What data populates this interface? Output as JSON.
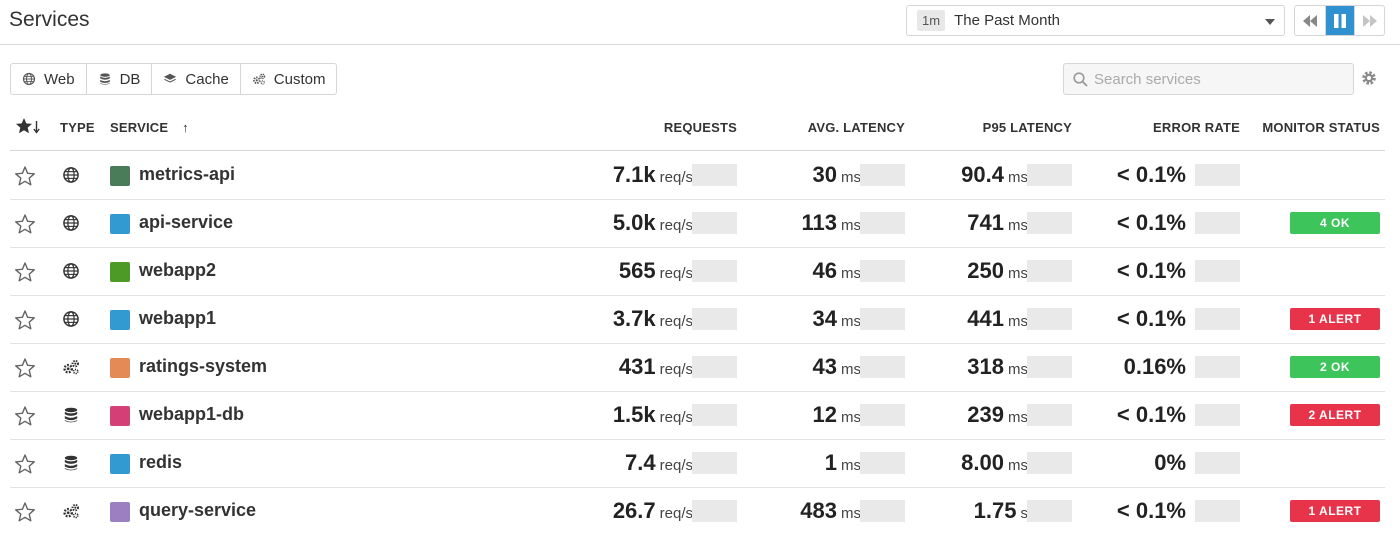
{
  "header": {
    "title": "Services",
    "timeframe": {
      "badge": "1m",
      "label": "The Past Month"
    }
  },
  "filters": [
    {
      "label": "Web",
      "icon": "globe-icon"
    },
    {
      "label": "DB",
      "icon": "database-icon"
    },
    {
      "label": "Cache",
      "icon": "layers-icon"
    },
    {
      "label": "Custom",
      "icon": "gears-icon"
    }
  ],
  "search": {
    "placeholder": "Search services",
    "value": ""
  },
  "columns": {
    "type": "TYPE",
    "service": "SERVICE",
    "sort_arrow": "↑",
    "requests": "REQUESTS",
    "avg_latency": "AVG. LATENCY",
    "p95_latency": "P95 LATENCY",
    "error_rate": "ERROR RATE",
    "monitor_status": "MONITOR STATUS"
  },
  "colors": {
    "ok": "#3dc55b",
    "alert": "#e8344b",
    "accent": "#2f91cf"
  },
  "services": [
    {
      "name": "metrics-api",
      "type": "globe-icon",
      "color": "#4a7c59",
      "requests": "7.1k",
      "requests_unit": "req/s",
      "avg": "30",
      "avg_unit": "ms",
      "p95": "90.4",
      "p95_unit": "ms",
      "error": "< 0.1%",
      "monitor": "",
      "monitor_kind": ""
    },
    {
      "name": "api-service",
      "type": "globe-icon",
      "color": "#3399d1",
      "requests": "5.0k",
      "requests_unit": "req/s",
      "avg": "113",
      "avg_unit": "ms",
      "p95": "741",
      "p95_unit": "ms",
      "error": "< 0.1%",
      "monitor": "4 OK",
      "monitor_kind": "ok"
    },
    {
      "name": "webapp2",
      "type": "globe-icon",
      "color": "#4e9a26",
      "requests": "565",
      "requests_unit": "req/s",
      "avg": "46",
      "avg_unit": "ms",
      "p95": "250",
      "p95_unit": "ms",
      "error": "< 0.1%",
      "monitor": "",
      "monitor_kind": ""
    },
    {
      "name": "webapp1",
      "type": "globe-icon",
      "color": "#3399d1",
      "requests": "3.7k",
      "requests_unit": "req/s",
      "avg": "34",
      "avg_unit": "ms",
      "p95": "441",
      "p95_unit": "ms",
      "error": "< 0.1%",
      "monitor": "1 ALERT",
      "monitor_kind": "alert"
    },
    {
      "name": "ratings-system",
      "type": "gears-icon",
      "color": "#e48a56",
      "requests": "431",
      "requests_unit": "req/s",
      "avg": "43",
      "avg_unit": "ms",
      "p95": "318",
      "p95_unit": "ms",
      "error": "0.16%",
      "monitor": "2 OK",
      "monitor_kind": "ok"
    },
    {
      "name": "webapp1-db",
      "type": "database-icon",
      "color": "#d43f75",
      "requests": "1.5k",
      "requests_unit": "req/s",
      "avg": "12",
      "avg_unit": "ms",
      "p95": "239",
      "p95_unit": "ms",
      "error": "< 0.1%",
      "monitor": "2 ALERT",
      "monitor_kind": "alert"
    },
    {
      "name": "redis",
      "type": "database-icon",
      "color": "#3399d1",
      "requests": "7.4",
      "requests_unit": "req/s",
      "avg": "1",
      "avg_unit": "ms",
      "p95": "8.00",
      "p95_unit": "ms",
      "error": "0%",
      "monitor": "",
      "monitor_kind": ""
    },
    {
      "name": "query-service",
      "type": "gears-icon",
      "color": "#9b7fc0",
      "requests": "26.7",
      "requests_unit": "req/s",
      "avg": "483",
      "avg_unit": "ms",
      "p95": "1.75",
      "p95_unit": "s",
      "error": "< 0.1%",
      "monitor": "1 ALERT",
      "monitor_kind": "alert"
    }
  ]
}
